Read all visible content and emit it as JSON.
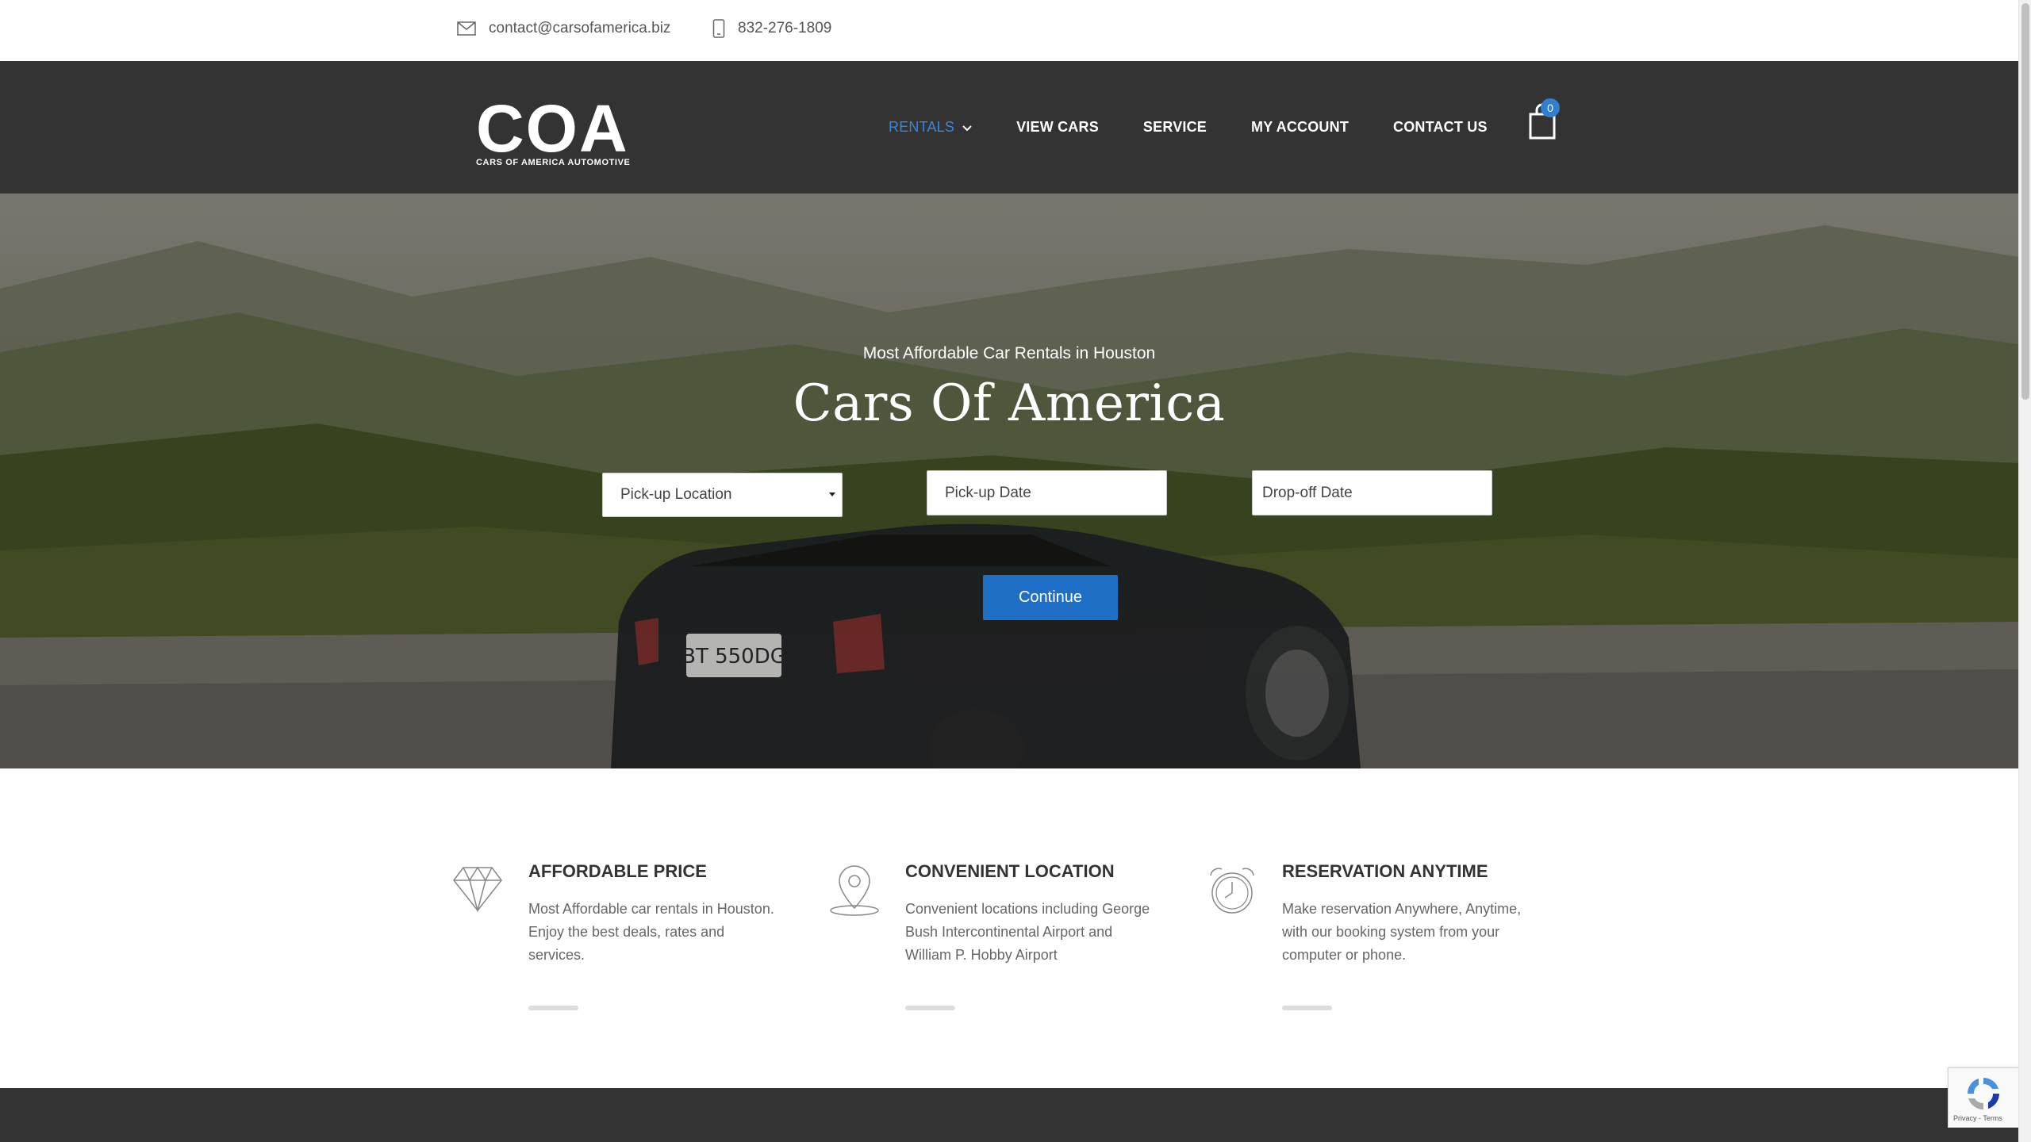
{
  "topbar": {
    "email": "contact@carsofamerica.biz",
    "phone": "832-276-1809"
  },
  "header": {
    "logo_mark": "COA",
    "logo_subtitle": "CARS OF AMERICA AUTOMOTIVE",
    "nav": [
      {
        "label": "RENTALS",
        "active": true,
        "has_dropdown": true
      },
      {
        "label": "VIEW CARS"
      },
      {
        "label": "SERVICE"
      },
      {
        "label": "MY ACCOUNT"
      },
      {
        "label": "CONTACT US"
      }
    ],
    "cart_count": "0"
  },
  "hero": {
    "subtitle": "Most Affordable Car Rentals in Houston",
    "title": "Cars Of America",
    "pickup_location": "Pick-up Location",
    "pickup_date_placeholder": "Pick-up Date",
    "dropoff_date_placeholder": "Drop-off Date",
    "continue_label": "Continue",
    "license_plate": "BT 550DG"
  },
  "features": [
    {
      "title": "AFFORDABLE PRICE",
      "text": "Most Affordable car rentals in Houston. Enjoy the best deals, rates and services.",
      "icon": "diamond-icon"
    },
    {
      "title": "CONVENIENT LOCATION",
      "text": "Convenient locations including George Bush Intercontinental Airport and William P. Hobby Airport",
      "icon": "map-pin-icon"
    },
    {
      "title": "RESERVATION ANYTIME",
      "text": "Make reservation Anywhere, Anytime, with our booking system from your computer or phone.",
      "icon": "alarm-clock-icon"
    }
  ],
  "recaptcha": {
    "text": "Privacy - Terms"
  },
  "colors": {
    "header_bg": "#333333",
    "accent": "#1e6fc5",
    "nav_active": "#3b86d6"
  }
}
